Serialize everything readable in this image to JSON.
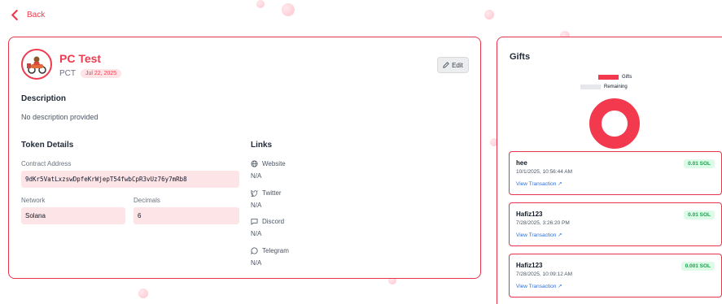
{
  "nav": {
    "back_label": "Back"
  },
  "token": {
    "name": "PC Test",
    "symbol": "PCT",
    "date": "Jul 22, 2025",
    "edit_label": "Edit"
  },
  "description": {
    "heading": "Description",
    "text": "No description provided"
  },
  "details": {
    "heading": "Token Details",
    "contract_label": "Contract Address",
    "contract_value": "9dKr5VatLxzswDpfeKrWjepT54fwbCpR3vUz76y7mRb8",
    "network_label": "Network",
    "network_value": "Solana",
    "decimals_label": "Decimals",
    "decimals_value": "6"
  },
  "links": {
    "heading": "Links",
    "items": [
      {
        "label": "Website",
        "value": "N/A",
        "icon": "globe-icon"
      },
      {
        "label": "Twitter",
        "value": "N/A",
        "icon": "twitter-icon"
      },
      {
        "label": "Discord",
        "value": "N/A",
        "icon": "message-square-icon"
      },
      {
        "label": "Telegram",
        "value": "N/A",
        "icon": "message-circle-icon"
      }
    ]
  },
  "gifts": {
    "heading": "Gifts",
    "legend": {
      "gifts_label": "Gifts",
      "remaining_label": "Remaining"
    },
    "colors": {
      "gifts": "#f2394d",
      "remaining": "#e5e7eb"
    },
    "chart_data": {
      "type": "pie",
      "labels": [
        "Gifts",
        "Remaining"
      ],
      "values": [
        1,
        0
      ]
    },
    "view_label": "View Transaction ↗",
    "items": [
      {
        "name": "hee",
        "date": "10/1/2025, 10:56:44 AM",
        "amount": "0.01 SOL"
      },
      {
        "name": "Hafiz123",
        "date": "7/28/2025, 3:26:20 PM",
        "amount": "0.01 SOL"
      },
      {
        "name": "Hafiz123",
        "date": "7/28/2025, 10:09:12 AM",
        "amount": "0.001 SOL"
      }
    ]
  }
}
